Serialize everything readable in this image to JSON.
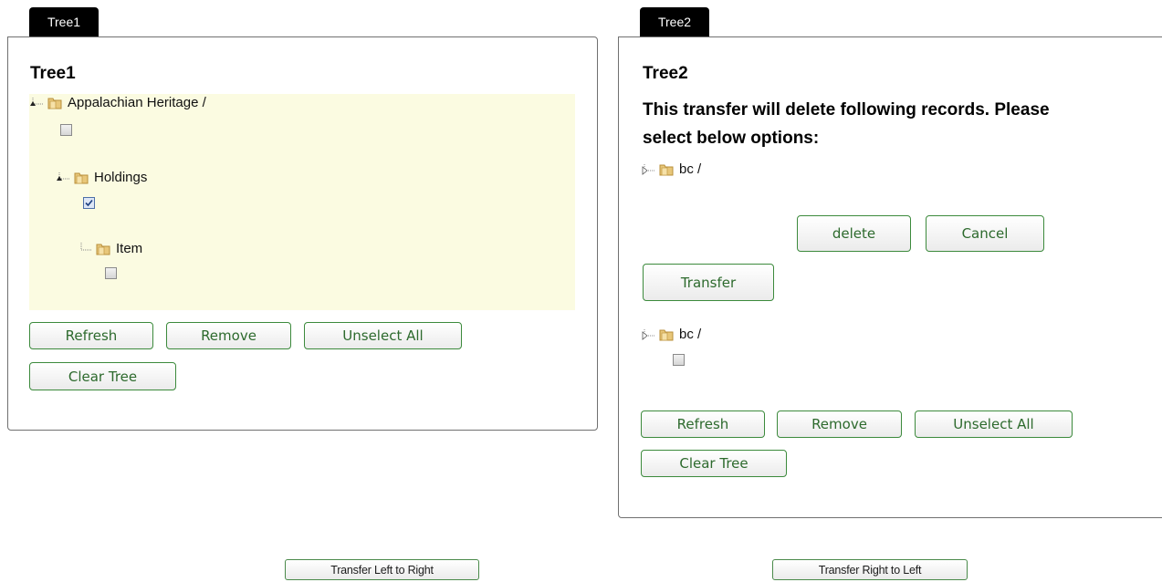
{
  "tree1": {
    "tab_label": "Tree1",
    "title": "Tree1",
    "nodes": [
      {
        "label": "Appalachian Heritage /",
        "checked": false
      },
      {
        "label": "Holdings",
        "checked": true
      },
      {
        "label": "Item",
        "checked": false
      }
    ],
    "buttons": {
      "refresh": "Refresh",
      "remove": "Remove",
      "unselect_all": "Unselect All",
      "clear_tree": "Clear Tree"
    }
  },
  "tree2": {
    "tab_label": "Tree2",
    "title": "Tree2",
    "warning_line1": "This transfer will delete following records. Please",
    "warning_line2": "select below options:",
    "confirm_node": {
      "label": "bc /"
    },
    "confirm_buttons": {
      "delete": "delete",
      "cancel": "Cancel"
    },
    "transfer_label": "Transfer",
    "nodes": [
      {
        "label": "bc /",
        "checked": false
      }
    ],
    "buttons": {
      "refresh": "Refresh",
      "remove": "Remove",
      "unselect_all": "Unselect All",
      "clear_tree": "Clear Tree"
    }
  },
  "footer": {
    "transfer_left_to_right": "Transfer Left to Right",
    "transfer_right_to_left": "Transfer Right to Left"
  },
  "icons": {
    "expander": "tree-expander-icon",
    "folder": "folder-icon"
  },
  "colors": {
    "tab_bg": "#000000",
    "tree_bg": "#fbfbe1",
    "button_border": "#3c8a3c",
    "button_text": "#2d6a2d"
  }
}
